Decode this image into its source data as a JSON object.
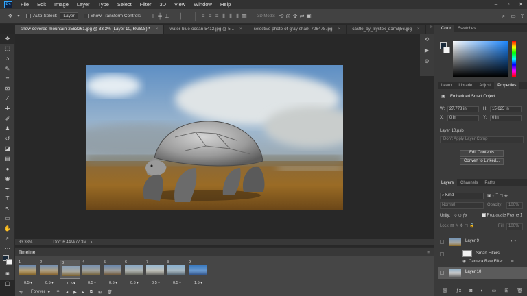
{
  "menubar": {
    "items": [
      "File",
      "Edit",
      "Image",
      "Layer",
      "Type",
      "Select",
      "Filter",
      "3D",
      "View",
      "Window",
      "Help"
    ],
    "logo": "Ps"
  },
  "options": {
    "auto_select_label": "Auto-Select:",
    "auto_select_value": "Layer",
    "transform_label": "Show Transform Controls",
    "mode_3d_label": "3D Mode:"
  },
  "tabs": [
    {
      "label": "snow-covered-mountain-2563261.jpg @ 33.3% (Layer 10, RGB/8) *",
      "active": true
    },
    {
      "label": "water-blue-ocean-5412.jpg @ 5...",
      "active": false
    },
    {
      "label": "selective-photo-of-gray-shark-726478.jpg",
      "active": false
    },
    {
      "label": "castle_by_lilystox_d1m3j56.jpg",
      "active": false
    }
  ],
  "status": {
    "zoom": "33.33%",
    "doc": "Doc: 6.44M/77.3M"
  },
  "timeline": {
    "title": "Timeline",
    "loop": "Forever",
    "frames": [
      {
        "num": "1",
        "dur": "0.5"
      },
      {
        "num": "2",
        "dur": "0.5"
      },
      {
        "num": "3",
        "dur": "0.5"
      },
      {
        "num": "4",
        "dur": "0.5"
      },
      {
        "num": "5",
        "dur": "0.5"
      },
      {
        "num": "6",
        "dur": "0.5"
      },
      {
        "num": "7",
        "dur": "0.5"
      },
      {
        "num": "8",
        "dur": "0.5"
      },
      {
        "num": "9",
        "dur": "1.5"
      }
    ],
    "selected_frame": 3
  },
  "color_panel": {
    "tabs": [
      "Color",
      "Swatches"
    ]
  },
  "props_panel": {
    "tabs": [
      "Learn",
      "Librarie",
      "Adjust",
      "Properties"
    ],
    "type": "Embedded Smart Object",
    "w_label": "W:",
    "w_value": "27.778 in",
    "h_label": "H:",
    "h_value": "15.625 in",
    "x_label": "X:",
    "x_value": "0 in",
    "y_label": "Y:",
    "y_value": "0 in",
    "file": "Layer 10.psb",
    "comp": "Don't Apply Layer Comp",
    "edit_btn": "Edit Contents",
    "convert_btn": "Convert to Linked..."
  },
  "layers_panel": {
    "tabs": [
      "Layers",
      "Channels",
      "Paths"
    ],
    "kind": "Kind",
    "blend": "Normal",
    "opacity_label": "Opacity:",
    "opacity_value": "100%",
    "unify_label": "Unify:",
    "propagate_label": "Propagate Frame 1",
    "lock_label": "Lock:",
    "fill_label": "Fill:",
    "fill_value": "100%",
    "layers": [
      {
        "name": "Layer 9"
      },
      {
        "name": "Smart Filters"
      },
      {
        "name": "Camera Raw Filter"
      },
      {
        "name": "Layer 10",
        "selected": true
      }
    ]
  },
  "colors": {
    "accent": "#31a8ff",
    "panel": "#3a3a3a",
    "canvas": "#282828"
  }
}
